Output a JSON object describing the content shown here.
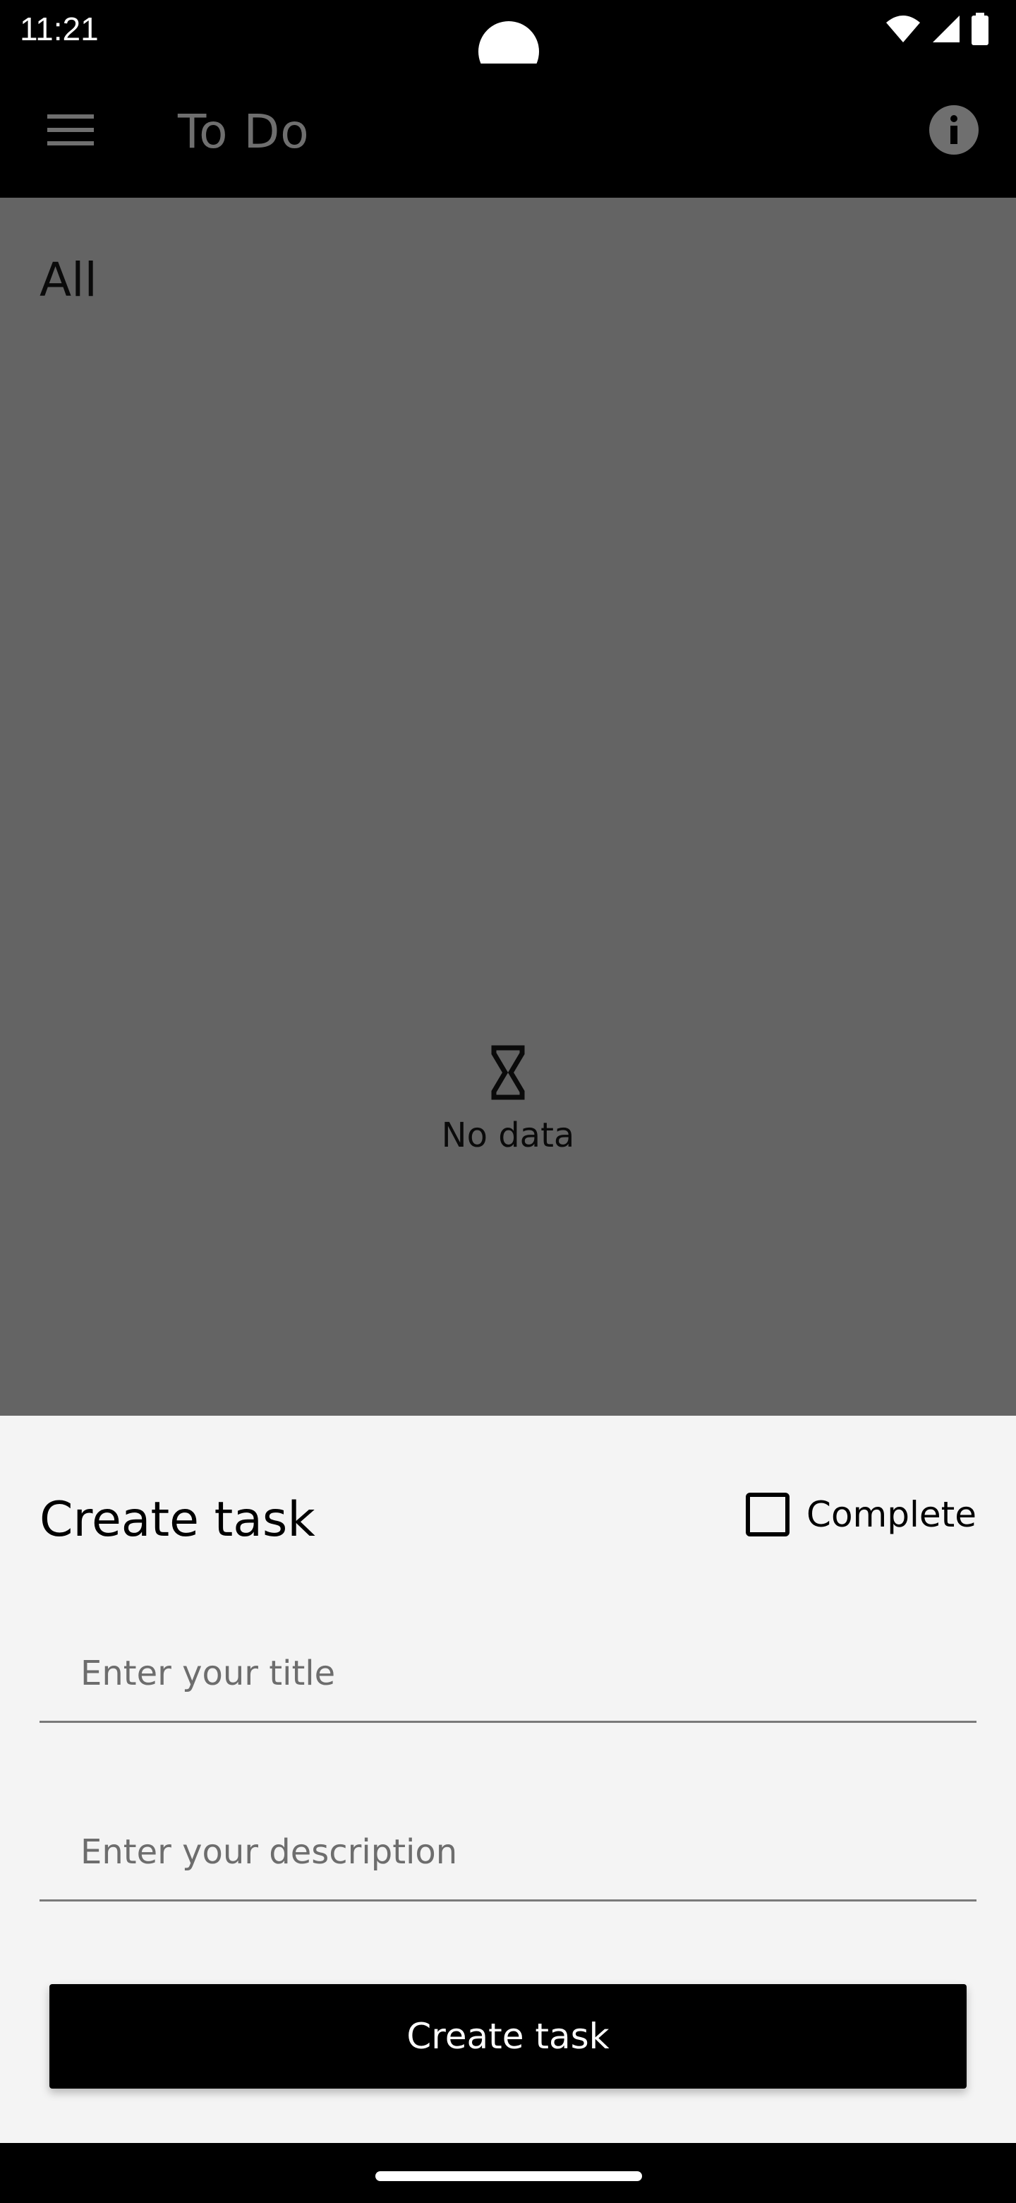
{
  "status_bar": {
    "time": "11:21",
    "icons": [
      "wifi-icon",
      "cell-signal-icon",
      "battery-icon"
    ]
  },
  "app_bar": {
    "title": "To Do",
    "menu_icon": "menu-icon",
    "info_icon": "info-icon"
  },
  "list": {
    "filter_label": "All",
    "empty_icon": "hourglass-icon",
    "empty_text": "No data"
  },
  "create_sheet": {
    "title": "Create task",
    "complete_label": "Complete",
    "complete_checked": false,
    "title_field": {
      "value": "",
      "placeholder": "Enter your title"
    },
    "description_field": {
      "value": "",
      "placeholder": "Enter your description"
    },
    "submit_label": "Create task"
  },
  "colors": {
    "app_bar_bg": "#000000",
    "scrim_bg": "#646464",
    "sheet_bg": "#f4f4f4",
    "button_bg": "#000000",
    "button_text": "#ffffff"
  }
}
